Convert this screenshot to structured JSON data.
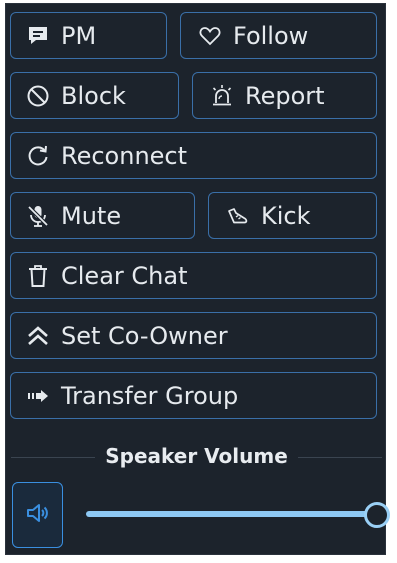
{
  "buttons": {
    "pm": {
      "label": "PM",
      "icon": "chat-bubble-icon"
    },
    "follow": {
      "label": "Follow",
      "icon": "heart-icon"
    },
    "block": {
      "label": "Block",
      "icon": "block-icon"
    },
    "report": {
      "label": "Report",
      "icon": "siren-icon"
    },
    "reconnect": {
      "label": "Reconnect",
      "icon": "refresh-icon"
    },
    "mute": {
      "label": "Mute",
      "icon": "mic-off-icon"
    },
    "kick": {
      "label": "Kick",
      "icon": "boot-icon"
    },
    "clear_chat": {
      "label": "Clear Chat",
      "icon": "trash-icon"
    },
    "set_co_owner": {
      "label": "Set Co-Owner",
      "icon": "double-chevron-up-icon"
    },
    "transfer_group": {
      "label": "Transfer Group",
      "icon": "transfer-arrow-icon"
    }
  },
  "volume": {
    "title": "Speaker Volume",
    "icon": "speaker-icon",
    "level": 1.0
  },
  "colors": {
    "panel_bg": "#1c232c",
    "button_border": "#3a6fa8",
    "text": "#e6eaee",
    "accent": "#8ec9f4"
  }
}
